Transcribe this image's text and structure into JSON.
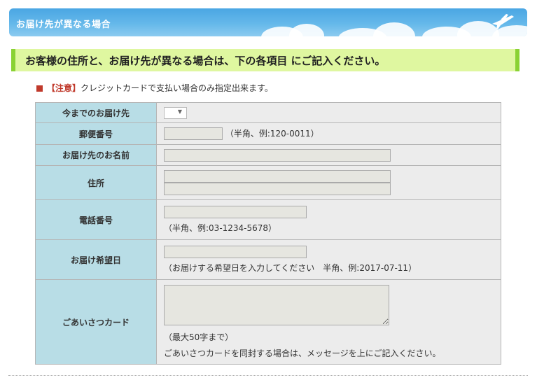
{
  "header": {
    "title": "お届け先が異なる場合"
  },
  "notice": "お客様の住所と、お届け先が異なる場合は、下の各項目 にご記入ください。",
  "note": {
    "label": "【注意】",
    "text": "クレジットカードで支払い場合のみ指定出来ます。"
  },
  "form": {
    "previous": {
      "label": "今までのお届け先",
      "value": ""
    },
    "postal": {
      "label": "郵便番号",
      "value": "",
      "hint": "（半角、例:120-0011）"
    },
    "name": {
      "label": "お届け先のお名前",
      "value": ""
    },
    "address": {
      "label": "住所",
      "line1": "",
      "line2": ""
    },
    "phone": {
      "label": "電話番号",
      "value": "",
      "hint": "（半角、例:03-1234-5678）"
    },
    "date": {
      "label": "お届け希望日",
      "value": "",
      "hint": "（お届けする希望日を入力してください　半角、例:2017-07-11）"
    },
    "card": {
      "label": "ごあいさつカード",
      "value": "",
      "hint1": "（最大50字まで）",
      "hint2": "ごあいさつカードを同封する場合は、メッセージを上にご記入ください。"
    }
  },
  "colors": {
    "header": "#5fb2e8",
    "notice_bg": "#dff7a0",
    "accent_green": "#8ad234",
    "label_bg": "#b8dde6"
  },
  "icons": {
    "plane": "airplane-icon"
  }
}
